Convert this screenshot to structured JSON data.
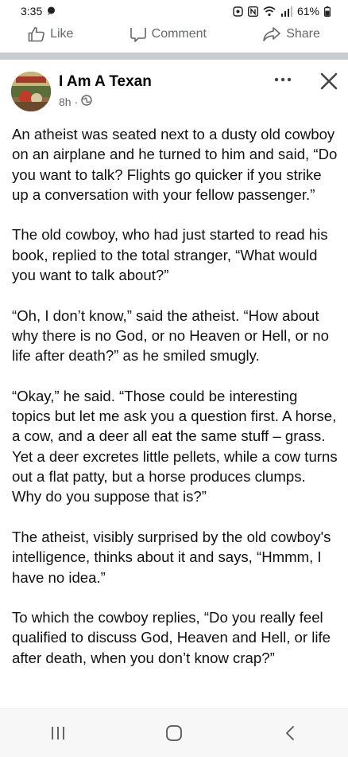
{
  "status_bar": {
    "time": "3:35",
    "battery": "61%",
    "icons": [
      "chat-bubble-icon",
      "alarm-icon",
      "nfc-icon",
      "wifi-icon",
      "signal-icon",
      "battery-icon"
    ]
  },
  "action_bar": {
    "like_label": "Like",
    "comment_label": "Comment",
    "share_label": "Share"
  },
  "post": {
    "author": "I Am A Texan",
    "time": "8h",
    "visibility_icon": "globe-icon",
    "paragraphs": [
      "An atheist was seated next to a dusty old cowboy on an airplane and he turned to him and said, “Do you want to talk? Flights go quicker if you strike up a conversation with your fellow passenger.”",
      "The old cowboy, who had just started to read his book, replied to the total stranger, “What would you want to talk about?”",
      "“Oh, I don’t know,” said the atheist. “How about why there is no God, or no Heaven or Hell, or no life after death?” as he smiled smugly.",
      "“Okay,” he said. “Those could be interesting topics but let me ask you a question first. A horse, a cow, and a deer all eat the same stuff – grass. Yet a deer excretes little pellets, while a cow turns out a flat patty, but a horse produces clumps. Why do you suppose that is?”",
      "The atheist, visibly surprised by the old cowboy's intelligence, thinks about it and says, “Hmmm, I have no idea.”",
      "To which the cowboy replies, “Do you really feel qualified to discuss God, Heaven and Hell, or life after death, when you don’t know crap?”"
    ]
  },
  "nav_bar": {
    "icons": [
      "recent-apps-icon",
      "home-icon",
      "back-icon"
    ]
  },
  "colors": {
    "text": "#111111",
    "secondary": "#65676b",
    "separator": "#c9ccd1"
  }
}
